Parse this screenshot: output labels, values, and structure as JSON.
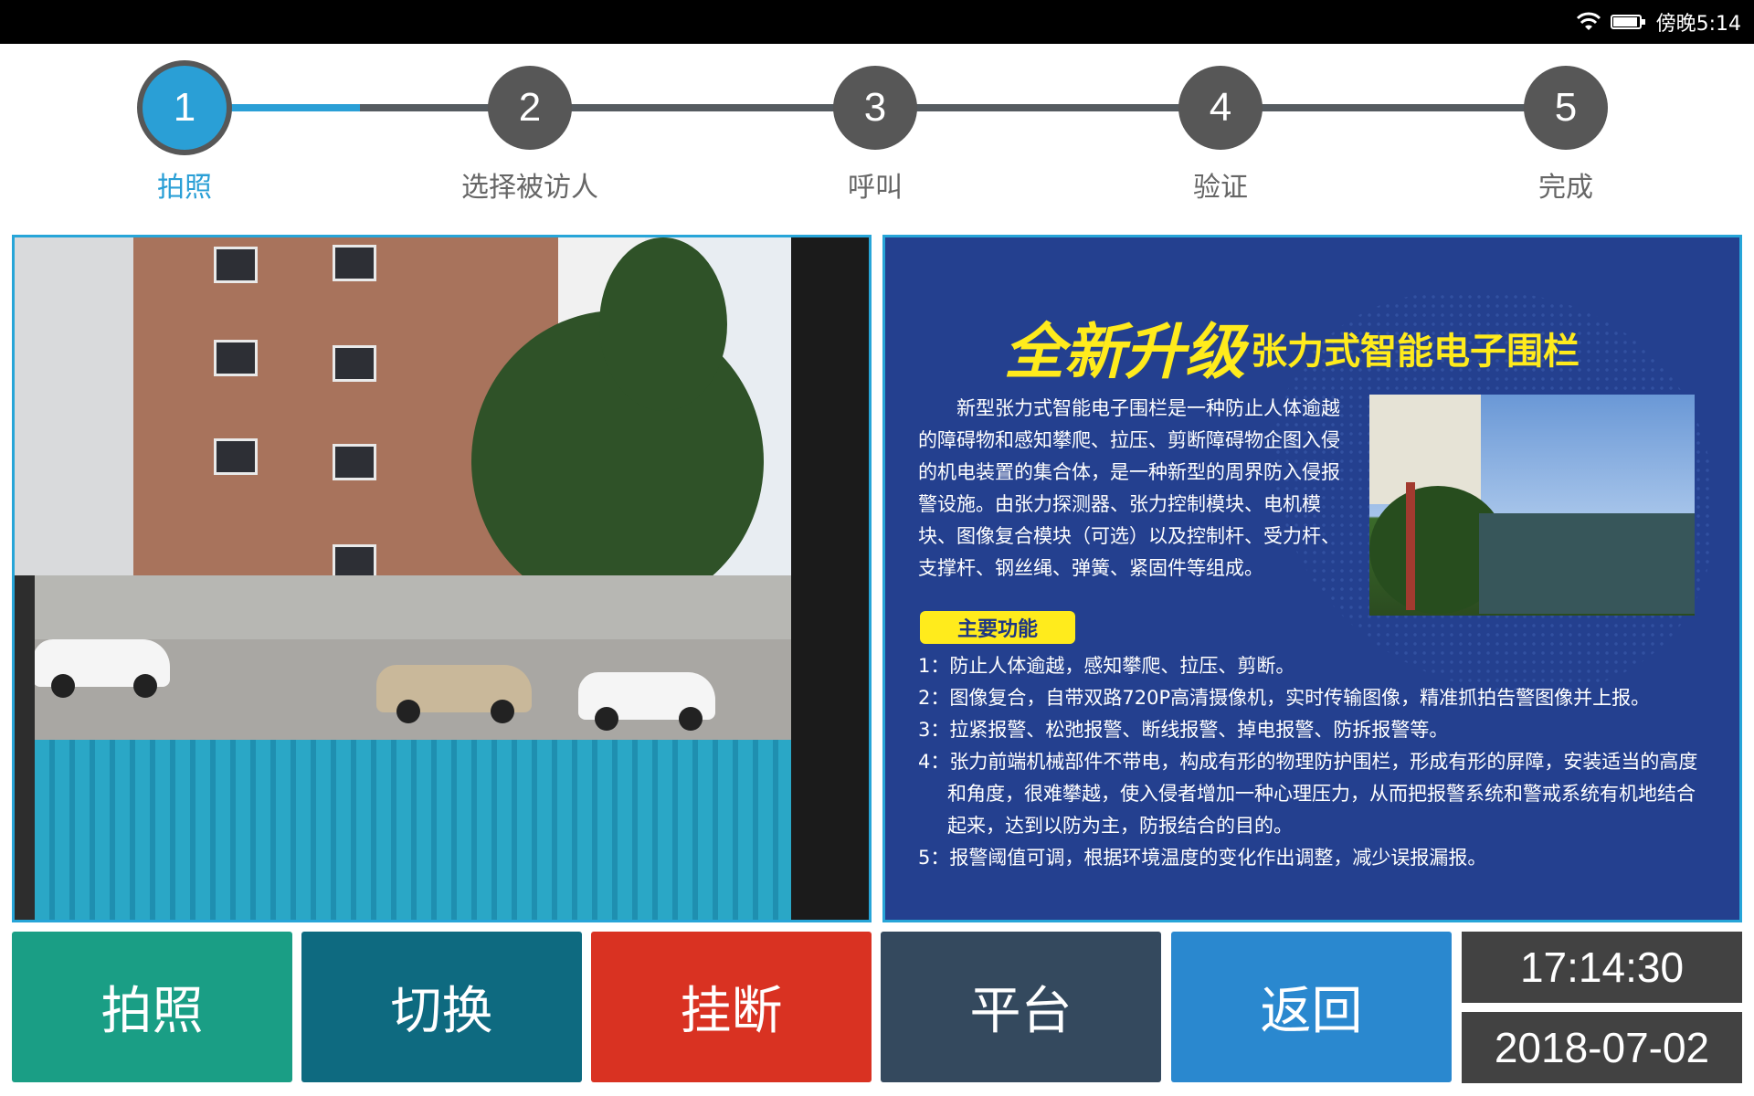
{
  "status_bar": {
    "time": "傍晚5:14",
    "icons": [
      "wifi-icon",
      "battery-icon"
    ]
  },
  "steps": [
    {
      "number": "1",
      "label": "拍照",
      "active": true
    },
    {
      "number": "2",
      "label": "选择被访人",
      "active": false
    },
    {
      "number": "3",
      "label": "呼叫",
      "active": false
    },
    {
      "number": "4",
      "label": "验证",
      "active": false
    },
    {
      "number": "5",
      "label": "完成",
      "active": false
    }
  ],
  "ad": {
    "title_main": "全新升级",
    "title_sub": "张力式智能电子围栏",
    "intro": "新型张力式智能电子围栏是一种防止人体逾越的障碍物和感知攀爬、拉压、剪断障碍物企图入侵的机电装置的集合体，是一种新型的周界防入侵报警设施。由张力探测器、张力控制模块、电机模块、图像复合模块（可选）以及控制杆、受力杆、支撑杆、钢丝绳、弹簧、紧固件等组成。",
    "badge": "主要功能",
    "features": [
      "1：防止人体逾越，感知攀爬、拉压、剪断。",
      "2：图像复合，自带双路720P高清摄像机，实时传输图像，精准抓拍告警图像并上报。",
      "3：拉紧报警、松弛报警、断线报警、掉电报警、防拆报警等。",
      "4：张力前端机械部件不带电，构成有形的物理防护围栏，形成有形的屏障，安装适当的高度和角度，很难攀越，使入侵者增加一种心理压力，从而把报警系统和警戒系统有机地结合起来，达到以防为主，防报结合的目的。",
      "5：报警阈值可调，根据环境温度的变化作出调整，减少误报漏报。"
    ]
  },
  "buttons": {
    "photo": "拍照",
    "switch": "切换",
    "hangup": "挂断",
    "platform": "平台",
    "back": "返回"
  },
  "clock": {
    "time": "17:14:30",
    "date": "2018-07-02"
  },
  "colors": {
    "accent": "#2a9fd6",
    "photo_button": "#1a9e85",
    "switch_button": "#0e6a80",
    "hangup_button": "#d93222",
    "platform_button": "#34495e",
    "back_button": "#2a88cf",
    "ad_background": "#24408f",
    "ad_title": "#ffeb1c"
  }
}
